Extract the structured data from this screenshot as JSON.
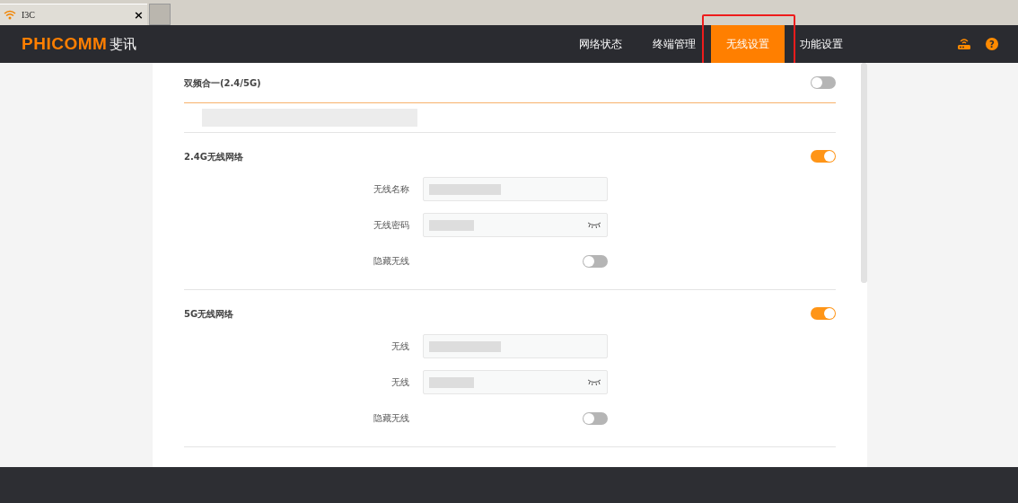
{
  "browser_tab": {
    "title": "I3C",
    "close": "×"
  },
  "header": {
    "help": "?",
    "logo": "PHICOMM",
    "logo_cn": "斐讯",
    "nav": [
      {
        "label": "网络状态",
        "selected": false
      },
      {
        "label": "终端管理",
        "selected": false
      },
      {
        "label": "无线设置",
        "selected": true,
        "annotated": true
      },
      {
        "label": "功能设置",
        "selected": false
      }
    ]
  },
  "sections": [
    {
      "kind": "toggle",
      "label": "双频合一(2.4/5G)",
      "on": false,
      "accent_line": true
    },
    {
      "kind": "redacted"
    },
    {
      "kind": "network",
      "label": "2.4G无线网络",
      "on": true,
      "fields": [
        {
          "kind": "text",
          "label": "无线名称"
        },
        {
          "kind": "password",
          "label": "无线密码"
        },
        {
          "kind": "toggle",
          "label": "隐藏无线",
          "on": false
        }
      ]
    },
    {
      "kind": "network",
      "label": "5G无线网络",
      "on": true,
      "fields": [
        {
          "kind": "text",
          "label": "无线"
        },
        {
          "kind": "password",
          "label": "无线"
        },
        {
          "kind": "toggle",
          "label": "隐藏无线",
          "on": false
        }
      ]
    }
  ]
}
